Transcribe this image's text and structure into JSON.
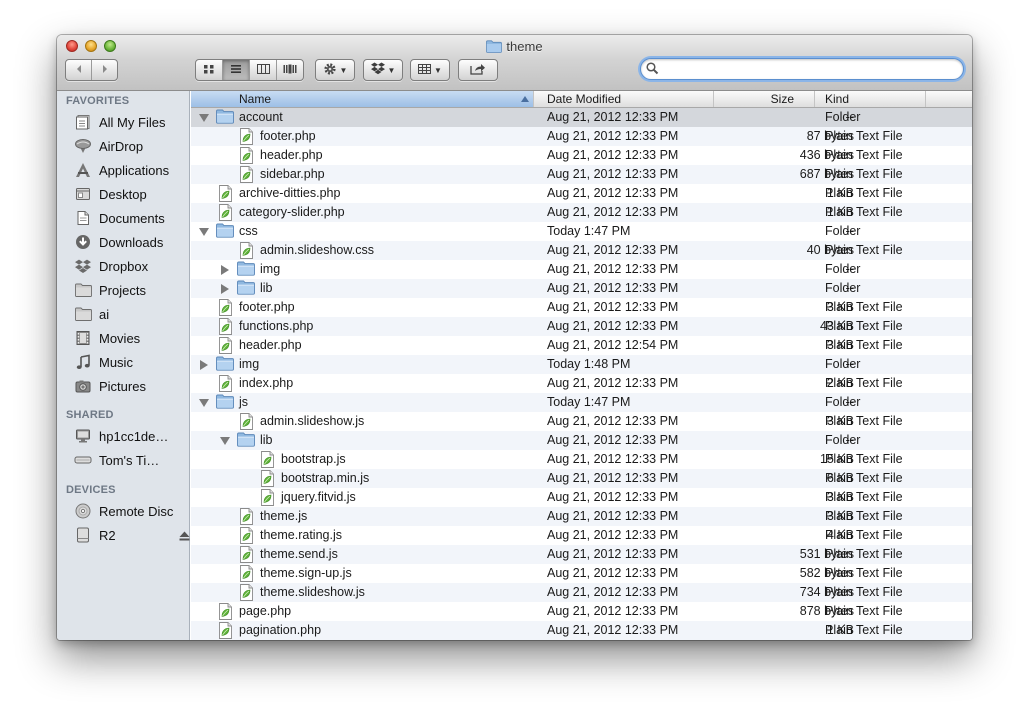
{
  "window": {
    "title": "theme"
  },
  "toolbar": {
    "back_icon": "chevron-left-icon",
    "forward_icon": "chevron-right-icon",
    "view_modes": [
      "icon-view-icon",
      "list-view-icon",
      "column-view-icon",
      "coverflow-view-icon"
    ],
    "active_view": "list-view-icon",
    "action_icon": "gear-icon",
    "dropbox_icon": "dropbox-icon",
    "arrange_icon": "arrange-grid-icon",
    "share_icon": "share-icon",
    "search": {
      "value": "",
      "placeholder": ""
    }
  },
  "sidebar": {
    "sections": [
      {
        "title": "FAVORITES",
        "items": [
          {
            "label": "All My Files",
            "icon": "all-files-icon"
          },
          {
            "label": "AirDrop",
            "icon": "airdrop-icon"
          },
          {
            "label": "Applications",
            "icon": "applications-icon"
          },
          {
            "label": "Desktop",
            "icon": "desktop-icon"
          },
          {
            "label": "Documents",
            "icon": "documents-icon"
          },
          {
            "label": "Downloads",
            "icon": "downloads-icon"
          },
          {
            "label": "Dropbox",
            "icon": "dropbox-icon"
          },
          {
            "label": "Projects",
            "icon": "folder-icon"
          },
          {
            "label": "ai",
            "icon": "folder-icon"
          },
          {
            "label": "Movies",
            "icon": "movies-icon"
          },
          {
            "label": "Music",
            "icon": "music-icon"
          },
          {
            "label": "Pictures",
            "icon": "pictures-icon"
          }
        ]
      },
      {
        "title": "SHARED",
        "items": [
          {
            "label": "hp1cc1de…",
            "icon": "computer-icon"
          },
          {
            "label": "Tom's Ti…",
            "icon": "time-capsule-icon"
          }
        ]
      },
      {
        "title": "DEVICES",
        "items": [
          {
            "label": "Remote Disc",
            "icon": "disc-icon"
          },
          {
            "label": "R2",
            "icon": "drive-icon",
            "eject": "eject-icon"
          }
        ]
      }
    ]
  },
  "columns": {
    "name": "Name",
    "date": "Date Modified",
    "size": "Size",
    "kind": "Kind"
  },
  "files": [
    {
      "name": "account",
      "date": "Aug 21, 2012 12:33 PM",
      "size": "--",
      "kind": "Folder",
      "depth": 0,
      "type": "folder",
      "disclosure": "open",
      "selected": true
    },
    {
      "name": "footer.php",
      "date": "Aug 21, 2012 12:33 PM",
      "size": "87 bytes",
      "kind": "Plain Text File",
      "depth": 1,
      "type": "file"
    },
    {
      "name": "header.php",
      "date": "Aug 21, 2012 12:33 PM",
      "size": "436 bytes",
      "kind": "Plain Text File",
      "depth": 1,
      "type": "file"
    },
    {
      "name": "sidebar.php",
      "date": "Aug 21, 2012 12:33 PM",
      "size": "687 bytes",
      "kind": "Plain Text File",
      "depth": 1,
      "type": "file"
    },
    {
      "name": "archive-ditties.php",
      "date": "Aug 21, 2012 12:33 PM",
      "size": "1 KB",
      "kind": "Plain Text File",
      "depth": 0,
      "type": "file"
    },
    {
      "name": "category-slider.php",
      "date": "Aug 21, 2012 12:33 PM",
      "size": "1 KB",
      "kind": "Plain Text File",
      "depth": 0,
      "type": "file"
    },
    {
      "name": "css",
      "date": "Today 1:47 PM",
      "size": "--",
      "kind": "Folder",
      "depth": 0,
      "type": "folder",
      "disclosure": "open"
    },
    {
      "name": "admin.slideshow.css",
      "date": "Aug 21, 2012 12:33 PM",
      "size": "40 bytes",
      "kind": "Plain Text File",
      "depth": 1,
      "type": "file"
    },
    {
      "name": "img",
      "date": "Aug 21, 2012 12:33 PM",
      "size": "--",
      "kind": "Folder",
      "depth": 1,
      "type": "folder",
      "disclosure": "closed"
    },
    {
      "name": "lib",
      "date": "Aug 21, 2012 12:33 PM",
      "size": "--",
      "kind": "Folder",
      "depth": 1,
      "type": "folder",
      "disclosure": "closed"
    },
    {
      "name": "footer.php",
      "date": "Aug 21, 2012 12:33 PM",
      "size": "3 KB",
      "kind": "Plain Text File",
      "depth": 0,
      "type": "file"
    },
    {
      "name": "functions.php",
      "date": "Aug 21, 2012 12:33 PM",
      "size": "43 KB",
      "kind": "Plain Text File",
      "depth": 0,
      "type": "file"
    },
    {
      "name": "header.php",
      "date": "Aug 21, 2012 12:54 PM",
      "size": "3 KB",
      "kind": "Plain Text File",
      "depth": 0,
      "type": "file"
    },
    {
      "name": "img",
      "date": "Today 1:48 PM",
      "size": "--",
      "kind": "Folder",
      "depth": 0,
      "type": "folder",
      "disclosure": "closed"
    },
    {
      "name": "index.php",
      "date": "Aug 21, 2012 12:33 PM",
      "size": "2 KB",
      "kind": "Plain Text File",
      "depth": 0,
      "type": "file"
    },
    {
      "name": "js",
      "date": "Today 1:47 PM",
      "size": "--",
      "kind": "Folder",
      "depth": 0,
      "type": "folder",
      "disclosure": "open"
    },
    {
      "name": "admin.slideshow.js",
      "date": "Aug 21, 2012 12:33 PM",
      "size": "3 KB",
      "kind": "Plain Text File",
      "depth": 1,
      "type": "file"
    },
    {
      "name": "lib",
      "date": "Aug 21, 2012 12:33 PM",
      "size": "--",
      "kind": "Folder",
      "depth": 1,
      "type": "folder",
      "disclosure": "open"
    },
    {
      "name": "bootstrap.js",
      "date": "Aug 21, 2012 12:33 PM",
      "size": "15 KB",
      "kind": "Plain Text File",
      "depth": 2,
      "type": "file"
    },
    {
      "name": "bootstrap.min.js",
      "date": "Aug 21, 2012 12:33 PM",
      "size": "6 KB",
      "kind": "Plain Text File",
      "depth": 2,
      "type": "file"
    },
    {
      "name": "jquery.fitvid.js",
      "date": "Aug 21, 2012 12:33 PM",
      "size": "3 KB",
      "kind": "Plain Text File",
      "depth": 2,
      "type": "file"
    },
    {
      "name": "theme.js",
      "date": "Aug 21, 2012 12:33 PM",
      "size": "3 KB",
      "kind": "Plain Text File",
      "depth": 1,
      "type": "file"
    },
    {
      "name": "theme.rating.js",
      "date": "Aug 21, 2012 12:33 PM",
      "size": "4 KB",
      "kind": "Plain Text File",
      "depth": 1,
      "type": "file"
    },
    {
      "name": "theme.send.js",
      "date": "Aug 21, 2012 12:33 PM",
      "size": "531 bytes",
      "kind": "Plain Text File",
      "depth": 1,
      "type": "file"
    },
    {
      "name": "theme.sign-up.js",
      "date": "Aug 21, 2012 12:33 PM",
      "size": "582 bytes",
      "kind": "Plain Text File",
      "depth": 1,
      "type": "file"
    },
    {
      "name": "theme.slideshow.js",
      "date": "Aug 21, 2012 12:33 PM",
      "size": "734 bytes",
      "kind": "Plain Text File",
      "depth": 1,
      "type": "file"
    },
    {
      "name": "page.php",
      "date": "Aug 21, 2012 12:33 PM",
      "size": "878 bytes",
      "kind": "Plain Text File",
      "depth": 0,
      "type": "file"
    },
    {
      "name": "pagination.php",
      "date": "Aug 21, 2012 12:33 PM",
      "size": "1 KB",
      "kind": "Plain Text File",
      "depth": 0,
      "type": "file"
    }
  ],
  "colors": {
    "selection": "#d4d7dc",
    "alt_row": "#f2f5fa",
    "sidebar_bg": "#dfe4ea",
    "sidebar_header": "#6e7885",
    "folder_blue": "#8fb8e0",
    "file_leaf_green": "#5fb33a"
  }
}
